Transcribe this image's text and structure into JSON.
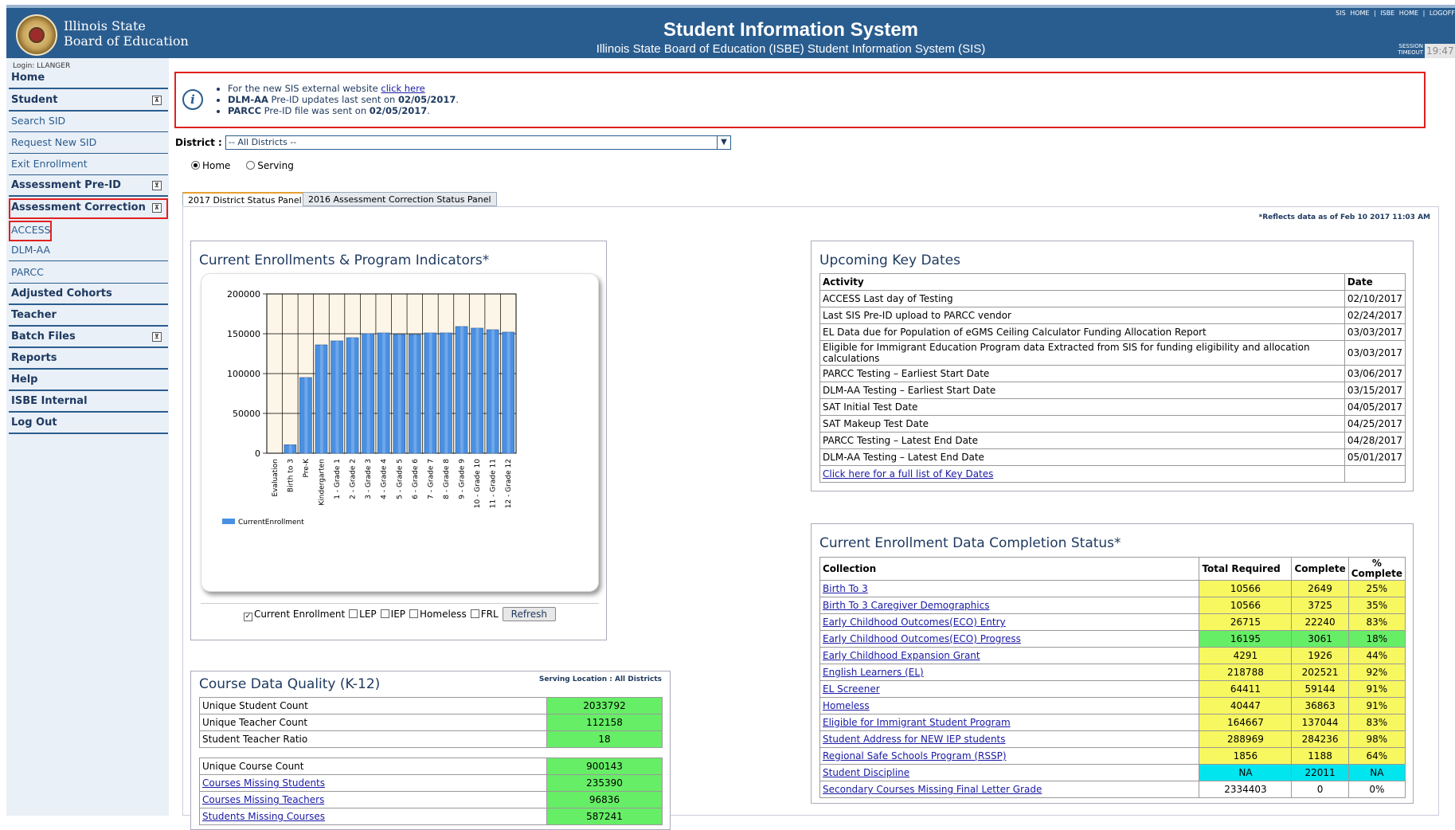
{
  "header": {
    "org_line1": "Illinois State",
    "org_line2": "Board of Education",
    "title": "Student Information System",
    "subtitle": "Illinois State Board of Education (ISBE) Student Information System (SIS)",
    "top_links": "SIS HOME  |  ISBE HOME  |  LOGOFF",
    "session_label1": "SESSION",
    "session_label2": "TIMEOUT",
    "timer": "19:47"
  },
  "sidebar": {
    "login": "Login: LLANGER",
    "items": [
      {
        "label": "Home"
      },
      {
        "label": "Student",
        "toggle": "⊼"
      },
      {
        "label": "Search SID"
      },
      {
        "label": "Request New SID"
      },
      {
        "label": "Exit Enrollment"
      },
      {
        "label": "Assessment Pre-ID",
        "toggle": "⊻"
      },
      {
        "label": "Assessment Correction",
        "toggle": "⊼"
      },
      {
        "label": "ACCESS"
      },
      {
        "label": "DLM-AA"
      },
      {
        "label": "PARCC"
      },
      {
        "label": "Adjusted Cohorts"
      },
      {
        "label": "Teacher"
      },
      {
        "label": "Batch Files",
        "toggle": "⊻"
      },
      {
        "label": "Reports"
      },
      {
        "label": "Help"
      },
      {
        "label": "ISBE Internal"
      },
      {
        "label": "Log Out"
      }
    ]
  },
  "notice": {
    "n1_text": "For the new SIS external website ",
    "n1_link": "click here",
    "n2_bold": "DLM-AA",
    "n2_text": " Pre-ID updates last sent on ",
    "n2_date": "02/05/2017",
    "n2_end": ".",
    "n3_bold": "PARCC",
    "n3_text": " Pre-ID file was sent on ",
    "n3_date": "02/05/2017",
    "n3_end": "."
  },
  "filters": {
    "district_label": "District :",
    "district_value": "-- All Districts --",
    "radio_home": "Home",
    "radio_serving": "Serving"
  },
  "tabs": [
    "2017 District Status Panel",
    "2016 Assessment Correction Status Panel"
  ],
  "as_of": "*Reflects data as of Feb 10 2017 11:03 AM",
  "enrollment_panel": {
    "title": "Current Enrollments & Program Indicators*",
    "legend": "CurrentEnrollment",
    "checkboxes": [
      "Current Enrollment",
      "LEP",
      "IEP",
      "Homeless",
      "FRL"
    ],
    "checked": [
      true,
      false,
      false,
      false,
      false
    ],
    "refresh": "Refresh"
  },
  "chart_data": {
    "type": "bar",
    "categories": [
      "Evaluation",
      "Birth to 3",
      "Pre-K",
      "Kindergarten",
      "1 - Grade 1",
      "2 - Grade 2",
      "3 - Grade 3",
      "4 - Grade 4",
      "5 - Grade 5",
      "6 - Grade 6",
      "7 - Grade 7",
      "8 - Grade 8",
      "9 - Grade 9",
      "10 - Grade 10",
      "11 - Grade 11",
      "12 - Grade 12"
    ],
    "series": [
      {
        "name": "CurrentEnrollment",
        "values": [
          0,
          10566,
          95000,
          136000,
          141000,
          145000,
          150000,
          151000,
          149000,
          149000,
          151000,
          151000,
          159000,
          157000,
          155000,
          152000
        ]
      }
    ],
    "yticks": [
      "200000",
      "150000",
      "100000",
      "50000",
      "0"
    ],
    "ylim": [
      0,
      200000
    ],
    "color": "#4a90e2"
  },
  "course_quality": {
    "title": "Course Data Quality (K-12)",
    "serving": "Serving Location : All Districts",
    "rows1": [
      {
        "label": "Unique Student Count",
        "value": "2033792"
      },
      {
        "label": "Unique Teacher Count",
        "value": "112158"
      },
      {
        "label": "Student Teacher Ratio",
        "value": "18"
      }
    ],
    "rows2": [
      {
        "label": "Unique Course Count",
        "value": "900143",
        "link": false
      },
      {
        "label": "Courses Missing Students",
        "value": "235390",
        "link": true
      },
      {
        "label": "Courses Missing Teachers",
        "value": "96836",
        "link": true
      },
      {
        "label": "Students Missing Courses",
        "value": "587241",
        "link": true
      }
    ]
  },
  "key_dates": {
    "title": "Upcoming Key Dates",
    "col_activity": "Activity",
    "col_date": "Date",
    "rows": [
      {
        "activity": "ACCESS Last day of Testing",
        "date": "02/10/2017"
      },
      {
        "activity": "Last SIS Pre-ID upload to PARCC vendor",
        "date": "02/24/2017"
      },
      {
        "activity": "EL Data due for Population of eGMS Ceiling Calculator Funding Allocation Report",
        "date": "03/03/2017"
      },
      {
        "activity": "Eligible for Immigrant Education Program data Extracted from SIS for funding eligibility and allocation calculations",
        "date": "03/03/2017"
      },
      {
        "activity": "PARCC Testing – Earliest Start Date",
        "date": "03/06/2017"
      },
      {
        "activity": "DLM-AA Testing – Earliest Start Date",
        "date": "03/15/2017"
      },
      {
        "activity": "SAT Initial Test Date",
        "date": "04/05/2017"
      },
      {
        "activity": "SAT Makeup Test Date",
        "date": "04/25/2017"
      },
      {
        "activity": "PARCC Testing – Latest End Date",
        "date": "04/28/2017"
      },
      {
        "activity": "DLM-AA Testing – Latest End Date",
        "date": "05/01/2017"
      }
    ],
    "full_list_link": "Click here for a full list of Key Dates"
  },
  "completion": {
    "title": "Current Enrollment Data Completion Status*",
    "col_collection": "Collection",
    "col_total": "Total Required",
    "col_complete": "Complete",
    "col_pct": "% Complete",
    "rows": [
      {
        "name": "Birth To 3",
        "total": "10566",
        "complete": "2649",
        "pct": "25%",
        "color": "y"
      },
      {
        "name": "Birth To 3 Caregiver Demographics",
        "total": "10566",
        "complete": "3725",
        "pct": "35%",
        "color": "y"
      },
      {
        "name": "Early Childhood Outcomes(ECO) Entry",
        "total": "26715",
        "complete": "22240",
        "pct": "83%",
        "color": "y"
      },
      {
        "name": "Early Childhood Outcomes(ECO) Progress",
        "total": "16195",
        "complete": "3061",
        "pct": "18%",
        "color": "gg"
      },
      {
        "name": "Early Childhood Expansion Grant",
        "total": "4291",
        "complete": "1926",
        "pct": "44%",
        "color": "y"
      },
      {
        "name": "English Learners (EL)",
        "total": "218788",
        "complete": "202521",
        "pct": "92%",
        "color": "y"
      },
      {
        "name": "EL Screener",
        "total": "64411",
        "complete": "59144",
        "pct": "91%",
        "color": "y"
      },
      {
        "name": "Homeless",
        "total": "40447",
        "complete": "36863",
        "pct": "91%",
        "color": "y"
      },
      {
        "name": "Eligible for Immigrant Student Program",
        "total": "164667",
        "complete": "137044",
        "pct": "83%",
        "color": "y"
      },
      {
        "name": "Student Address for NEW IEP students",
        "total": "288969",
        "complete": "284236",
        "pct": "98%",
        "color": "y"
      },
      {
        "name": "Regional Safe Schools Program (RSSP)",
        "total": "1856",
        "complete": "1188",
        "pct": "64%",
        "color": "y"
      },
      {
        "name": "Student Discipline",
        "total": "NA",
        "complete": "22011",
        "pct": "NA",
        "color": "c"
      },
      {
        "name": "Secondary Courses Missing Final Letter Grade",
        "total": "2334403",
        "complete": "0",
        "pct": "0%",
        "color": "w"
      }
    ]
  }
}
